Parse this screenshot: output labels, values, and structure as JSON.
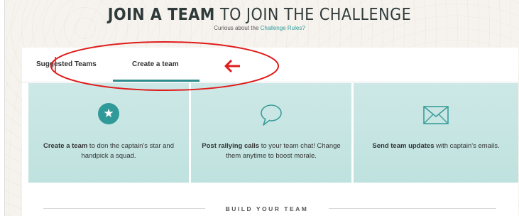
{
  "header": {
    "title_strong": "JOIN A TEAM",
    "title_light": " TO JOIN THE CHALLENGE",
    "subtitle_prefix": "Curious about the ",
    "subtitle_link": "Challenge Rules?"
  },
  "tabs": [
    {
      "label": "Suggested Teams",
      "active": false
    },
    {
      "label": "Create a team",
      "active": true
    }
  ],
  "cards": [
    {
      "icon": "star-icon",
      "bold": "Create a team",
      "rest": " to don the captain's star and handpick a squad."
    },
    {
      "icon": "chat-bubble-icon",
      "bold": "Post rallying calls",
      "rest": " to your team chat! Change them anytime to boost morale."
    },
    {
      "icon": "envelope-icon",
      "bold": "Send team updates",
      "rest": " with captain's emails."
    }
  ],
  "section_label": "BUILD YOUR TEAM",
  "annotation": {
    "color": "#e01b1b",
    "arrow": "←"
  }
}
